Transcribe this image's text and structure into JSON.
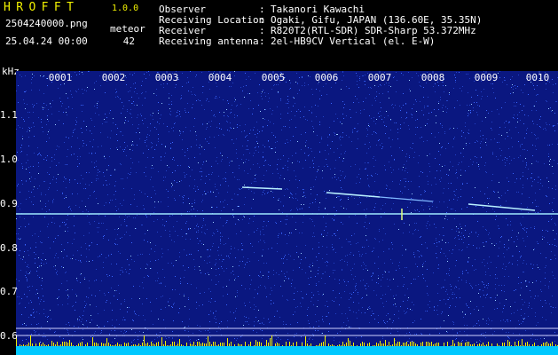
{
  "header": {
    "app_title": "HROFFT",
    "app_version": "1.0.0",
    "file_name": "2504240000.png",
    "datetime": "25.04.24 00:00",
    "meteor_label": "meteor",
    "meteor_count": "42",
    "info": [
      {
        "label": "Observer",
        "value": "Takanori Kawachi"
      },
      {
        "label": "Receiving Location",
        "value": "Ogaki, Gifu, JAPAN (136.60E, 35.35N)"
      },
      {
        "label": "Receiver",
        "value": "R820T2(RTL-SDR) SDR-Sharp 53.372MHz"
      },
      {
        "label": "Receiving antenna",
        "value": "2el-HB9CV Vertical (el. E-W)"
      }
    ],
    "colon": ":"
  },
  "spectrogram": {
    "unit_label": "kHz",
    "columns": [
      "0001",
      "0002",
      "0003",
      "0004",
      "0005",
      "0006",
      "0007",
      "0008",
      "0009",
      "0010"
    ],
    "y_ticks": [
      "1.1",
      "1.0",
      "0.9",
      "0.8",
      "0.7",
      "0.6"
    ],
    "colors": {
      "background": "#0a1780",
      "noise": "#3a66ff",
      "carrier": "#9fe8ff",
      "meteor_trail": "#b8f0ff",
      "bottom_band": "#00c8ff",
      "spikes": "#f0f000",
      "grid": "#3c4fbf"
    }
  }
}
